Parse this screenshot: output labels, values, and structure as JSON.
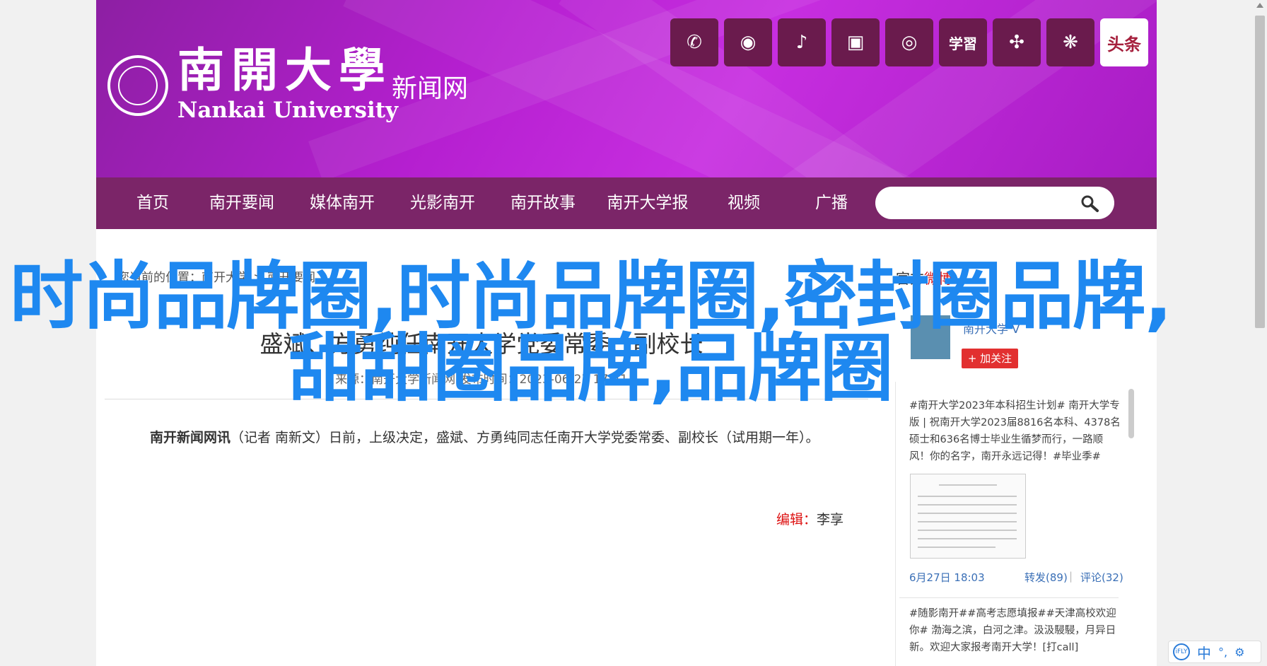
{
  "header": {
    "logo_cn": "南開大學",
    "logo_en": "Nankai University",
    "logo_sub": "新闻网",
    "socials": [
      {
        "icon": "wechat-icon",
        "glyph": "✆"
      },
      {
        "icon": "weibo-icon",
        "glyph": "◉"
      },
      {
        "icon": "tiktok-icon",
        "glyph": "♪"
      },
      {
        "icon": "bilibili-icon",
        "glyph": "▣"
      },
      {
        "icon": "kuaishou-icon",
        "glyph": "◎"
      },
      {
        "icon": "xuexi-icon",
        "glyph": "学習"
      },
      {
        "icon": "network-icon",
        "glyph": "✣"
      },
      {
        "icon": "dandelion-icon",
        "glyph": "❋"
      },
      {
        "icon": "toutiao-icon",
        "glyph": "头条"
      }
    ]
  },
  "nav": {
    "items": [
      "首页",
      "南开要闻",
      "媒体南开",
      "光影南开",
      "南开故事",
      "南开大学报",
      "视频",
      "广播"
    ],
    "search_placeholder": ""
  },
  "breadcrumb": "您当前的位置：南开大学 > 南开要闻",
  "article": {
    "title": "盛斌、方勇纯任南开大学党委常委、副校长",
    "meta": "来源：南开大学新闻网   发布时间：2023-06-27 17:41",
    "lead": "南开新闻网讯",
    "body": "（记者 南新文）日前，上级决定，盛斌、方勇纯同志任南开大学党委常委、副校长（试用期一年）。",
    "editor_label": "编辑：",
    "editor_name": "李享"
  },
  "sidebar": {
    "title_prefix": "官方",
    "title_highlight": "微博",
    "profile_name": "南开大学 V",
    "follow_label": "+ 加关注",
    "post_text": "#南开大学2023年本科招生计划# 南开大学专版 | 祝南开大学2023届8816名本科、4378名硕士和636名博士毕业生循梦而行，一路顺风！你的名字，南开永远记得！#毕业季#",
    "post_date": "6月27日 18:03",
    "post_share": "转发(89)",
    "post_sep": "|",
    "post_comment": "评论(32)",
    "post2_text": "#随影南开##高考志愿填报##天津高校欢迎你# 渤海之滨，白河之津。汲汲駸駸，月异日新。欢迎大家报考南开大学！[打call]"
  },
  "overlay_title": "时尚品牌圈,时尚品牌圈,密封圈品牌,甜甜圈品牌,品牌圈",
  "ime": {
    "logo": "iFLY",
    "lang": "中",
    "dot": "°,",
    "gear": "⚙"
  }
}
